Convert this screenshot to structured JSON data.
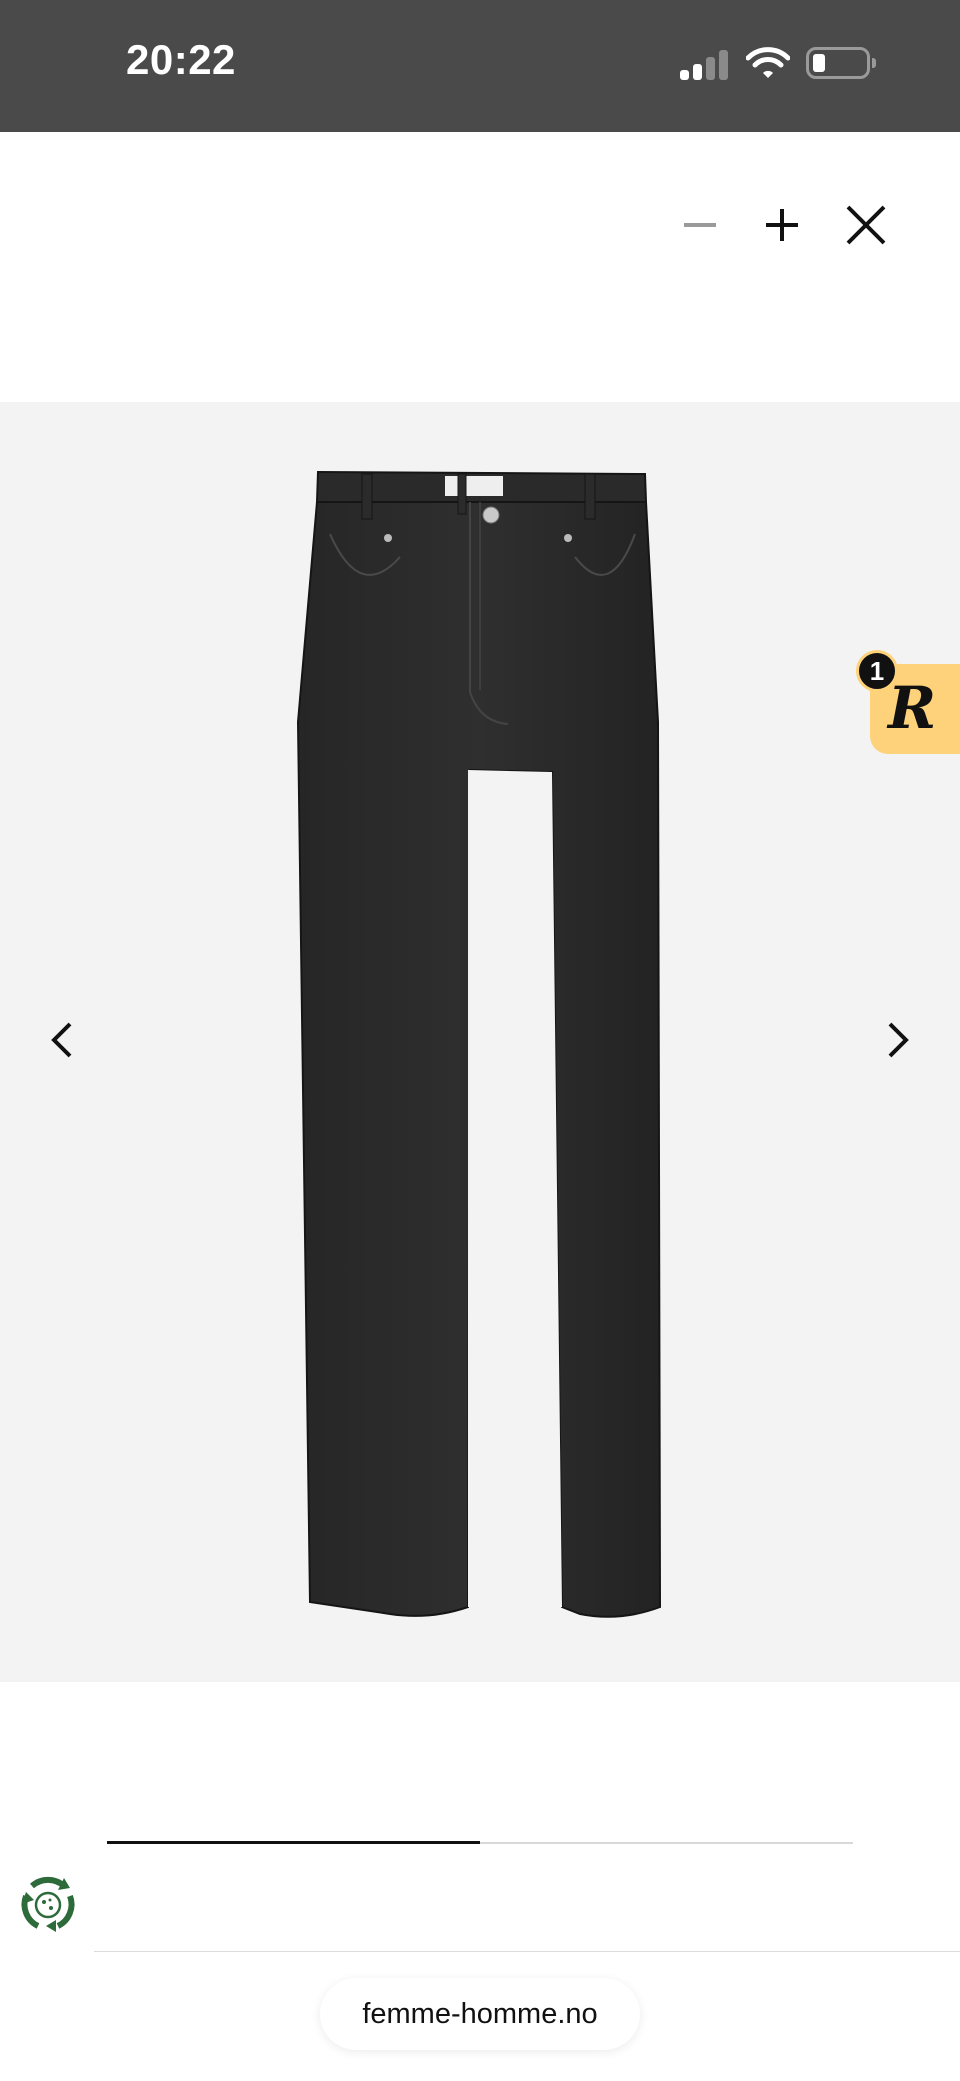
{
  "status_bar": {
    "time": "20:22"
  },
  "toolbar": {
    "zoom_out_icon": "minus-icon",
    "zoom_in_icon": "plus-icon",
    "close_icon": "close-icon"
  },
  "gallery": {
    "product_image": "black wide-leg jeans",
    "prev_icon": "chevron-left-icon",
    "next_icon": "chevron-right-icon",
    "progress_fraction": 0.5
  },
  "rewards": {
    "badge_count": "1",
    "logo_letter": "R",
    "accent_color": "#fdd27a"
  },
  "browser": {
    "url": "femme-homme.no"
  },
  "colors": {
    "status_bar": "#4a4a4a",
    "stage": "#f3f3f3"
  }
}
